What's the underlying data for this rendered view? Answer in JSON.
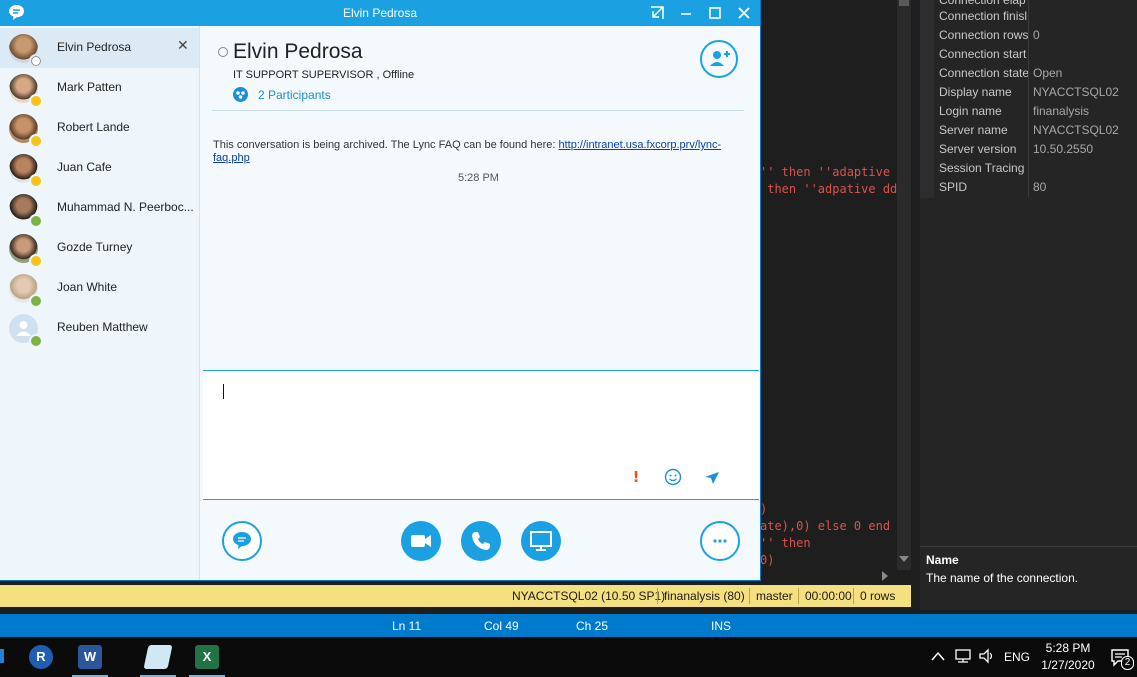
{
  "skype": {
    "title": "Elvin Pedrosa",
    "contacts": [
      {
        "name": "Elvin Pedrosa",
        "presence": "offline",
        "selected": true,
        "close_label": "✕"
      },
      {
        "name": "Mark Patten",
        "presence": "away"
      },
      {
        "name": "Robert Lande",
        "presence": "away"
      },
      {
        "name": "Juan Cafe",
        "presence": "away"
      },
      {
        "name": "Muhammad N. Peerboc...",
        "presence": "available"
      },
      {
        "name": "Gozde Turney",
        "presence": "away"
      },
      {
        "name": "Joan White",
        "presence": "available"
      },
      {
        "name": "Reuben Matthew",
        "presence": "available"
      }
    ],
    "conversation": {
      "name": "Elvin Pedrosa",
      "title_status": "IT SUPPORT SUPERVISOR ,  Offline",
      "participants": "2 Participants",
      "archive_text": "This conversation is being archived. The Lync FAQ can be found here: ",
      "archive_link": "http://intranet.usa.fxcorp.prv/lync-faq.php",
      "time": "5:28 PM"
    },
    "colors": {
      "accent": "#1ba1e2",
      "away": "#f5c518",
      "available": "#7cb342",
      "important": "#e8541e"
    }
  },
  "editor": {
    "code_lines": [
      {
        "text": "'' then ''adaptive s"
      },
      {
        "text": " then ''adpative dd"
      },
      {
        "text": ")"
      },
      {
        "text": "ate),0) else 0 end"
      },
      {
        "text": "'' then"
      },
      {
        "text": "0)"
      }
    ]
  },
  "properties": {
    "rows": [
      {
        "key": "Connection elap",
        "value": ""
      },
      {
        "key": "Connection finisl",
        "value": ""
      },
      {
        "key": "Connection rows",
        "value": "0"
      },
      {
        "key": "Connection start",
        "value": ""
      },
      {
        "key": "Connection state",
        "value": "Open"
      },
      {
        "key": "Display name",
        "value": "NYACCTSQL02"
      },
      {
        "key": "Login name",
        "value": "finanalysis"
      },
      {
        "key": "Server name",
        "value": "NYACCTSQL02"
      },
      {
        "key": "Server version",
        "value": "10.50.2550"
      },
      {
        "key": "Session Tracing II",
        "value": ""
      },
      {
        "key": "SPID",
        "value": "80"
      }
    ],
    "desc_name": "Name",
    "desc_text": "The name of the connection."
  },
  "query_status": {
    "server": "NYACCTSQL02 (10.50 SP1)",
    "login": "finanalysis (80)",
    "database": "master",
    "elapsed": "00:00:00",
    "rows": "0 rows"
  },
  "editor_status": {
    "ln": "Ln 11",
    "col": "Col 49",
    "ch": "Ch 25",
    "mode": "INS"
  },
  "taskbar": {
    "apps": [
      {
        "name": "r-app-icon",
        "glyph": "R"
      },
      {
        "name": "word-icon",
        "glyph": "W"
      },
      {
        "name": "notepad-icon",
        "glyph": ""
      },
      {
        "name": "excel-icon",
        "glyph": "X"
      }
    ],
    "language": "ENG",
    "time": "5:28 PM",
    "date": "1/27/2020",
    "notification_count": "2"
  }
}
